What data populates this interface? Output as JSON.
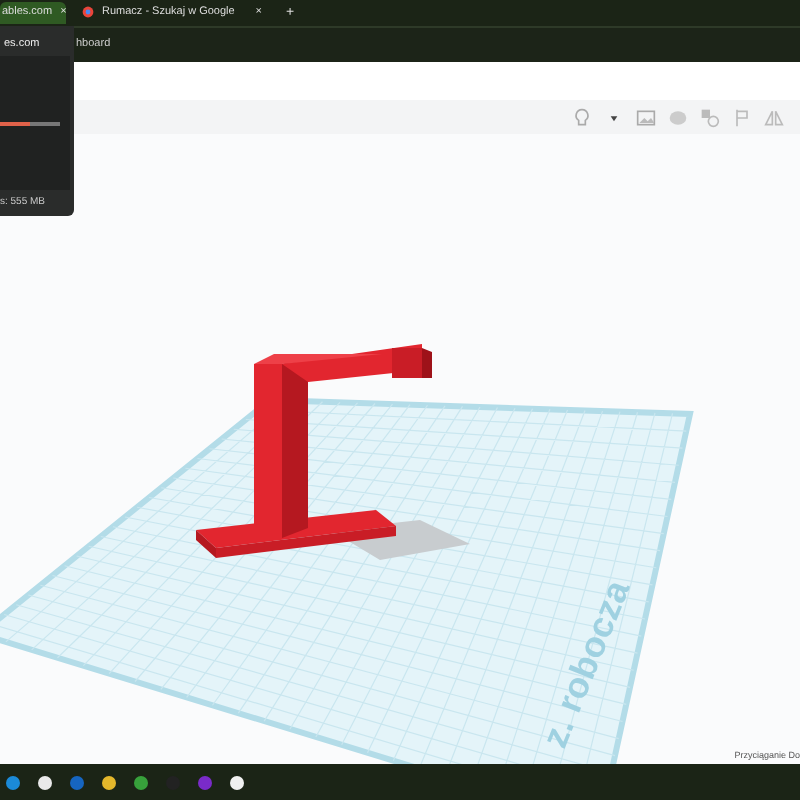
{
  "browser": {
    "tabs": [
      {
        "title": "ables.com",
        "close": "×",
        "selected": true
      },
      {
        "title": "Rumacz - Szukaj w Google",
        "close": "×",
        "selected": false
      }
    ],
    "new_tab": "+",
    "bookmark": "hboard"
  },
  "popup": {
    "title": "es.com",
    "memory": "s: 555 MB",
    "level": 0.5
  },
  "workplane": {
    "label": "z. robocza"
  },
  "snap_label": "Przyciąganie Do"
}
